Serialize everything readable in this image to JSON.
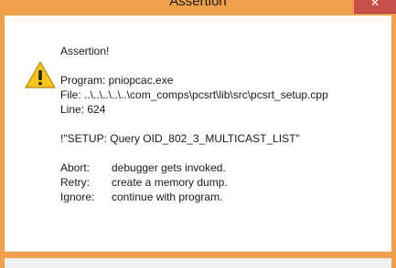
{
  "window": {
    "title": "Assertion",
    "close_glyph": "✕"
  },
  "icon": "warning-icon",
  "message": {
    "heading": "Assertion!",
    "program": "Program: pniopcac.exe",
    "file": "File: ..\\..\\..\\..\\..\\com_comps\\pcsrt\\lib\\src\\pcsrt_setup.cpp",
    "line": "Line: 624",
    "expression": "!\"SETUP: Query OID_802_3_MULTICAST_LIST\"",
    "options": [
      {
        "key": "Abort:",
        "desc": "debugger gets invoked."
      },
      {
        "key": "Retry:",
        "desc": "create a memory dump."
      },
      {
        "key": "Ignore:",
        "desc": "continue with program."
      }
    ]
  },
  "colors": {
    "titlebar": "#f0a04b",
    "close_button": "#c7504a",
    "warning_fill": "#f5c518"
  }
}
